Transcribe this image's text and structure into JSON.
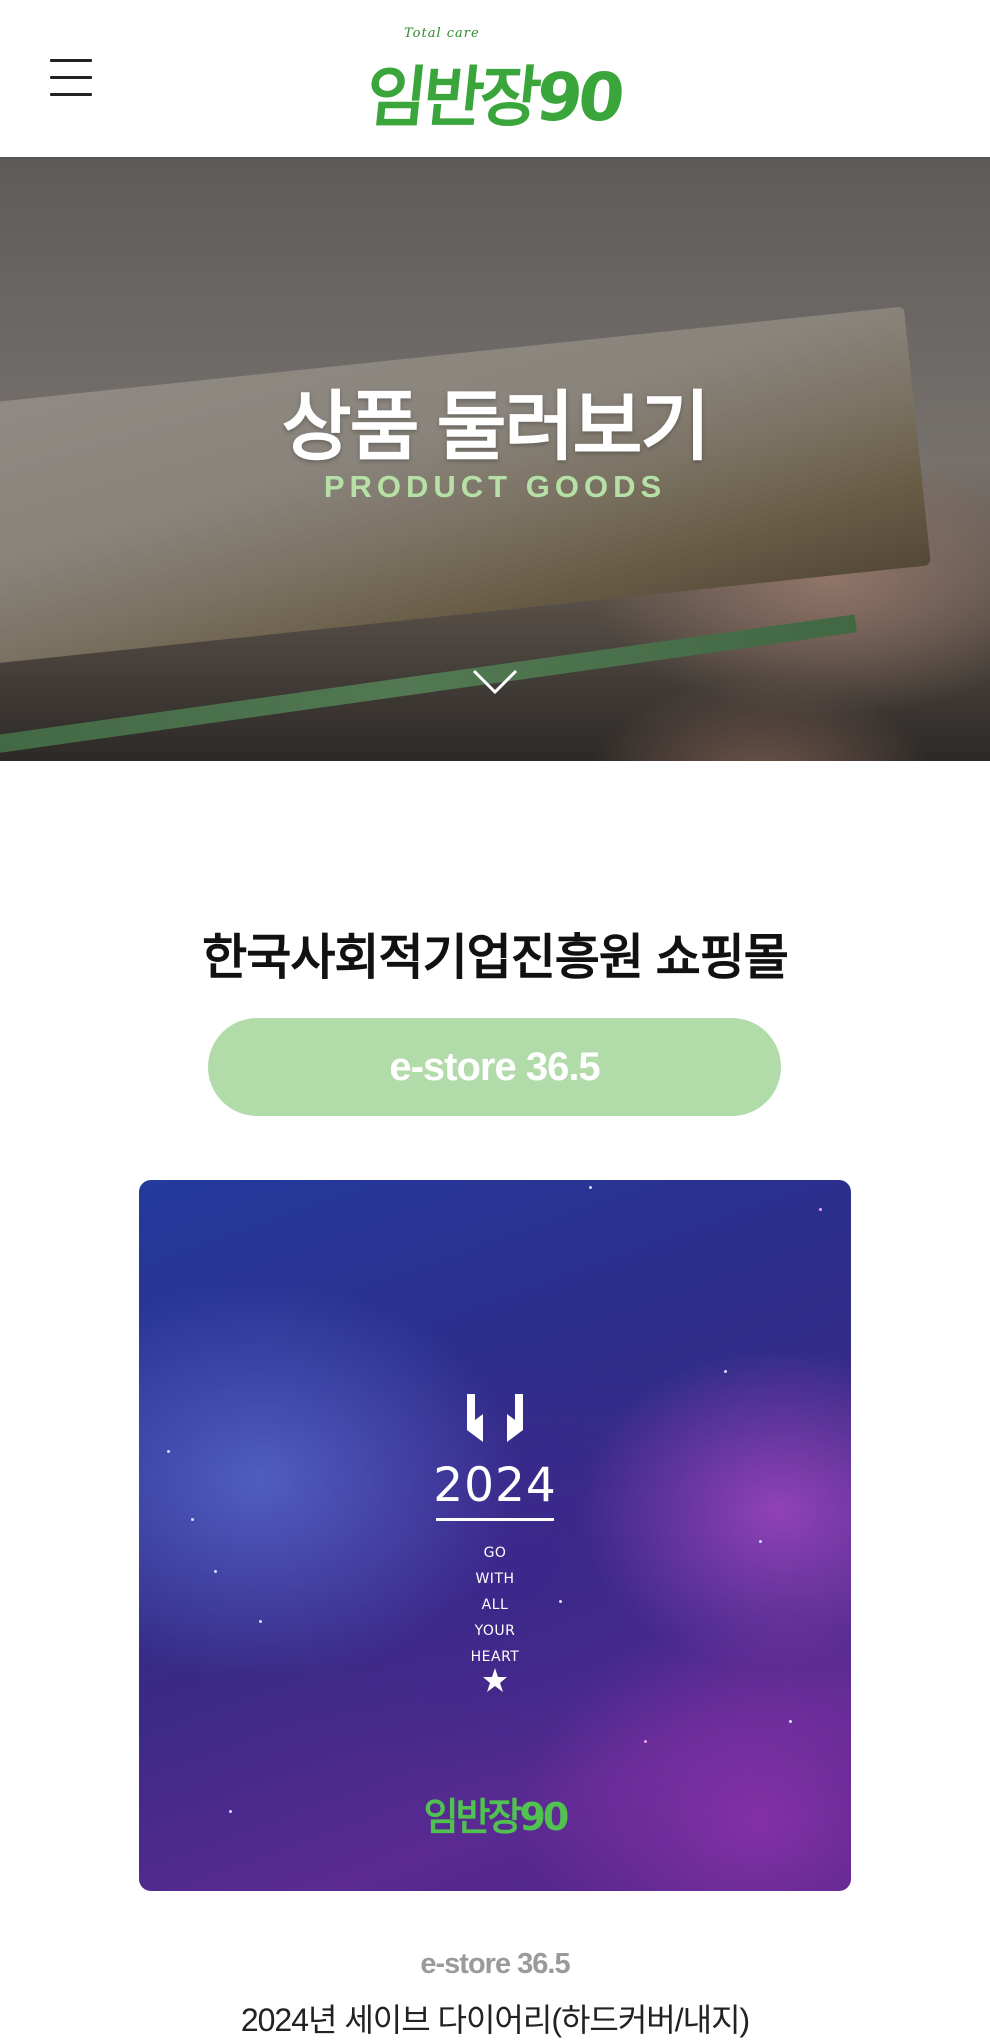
{
  "header": {
    "menu_icon": "hamburger-menu-icon",
    "logo_small_text": "Total care",
    "logo_text": "임반장90"
  },
  "hero": {
    "title": "상품 둘러보기",
    "subtitle": "PRODUCT GOODS",
    "scroll_icon": "chevron-down-icon"
  },
  "main": {
    "section_title": "한국사회적기업진흥원 쇼핑몰",
    "store_button_label": "e-store 36.5",
    "accent_color": "#b2dbaa"
  },
  "product": {
    "image": {
      "year": "2024",
      "slogan": [
        "GO",
        "WITH",
        "ALL",
        "YOUR",
        "HEART"
      ],
      "brand": "임반장90"
    },
    "store_label": "e-store 36.5",
    "name": "2024년 세이브 다이어리(하드커버/내지)"
  }
}
